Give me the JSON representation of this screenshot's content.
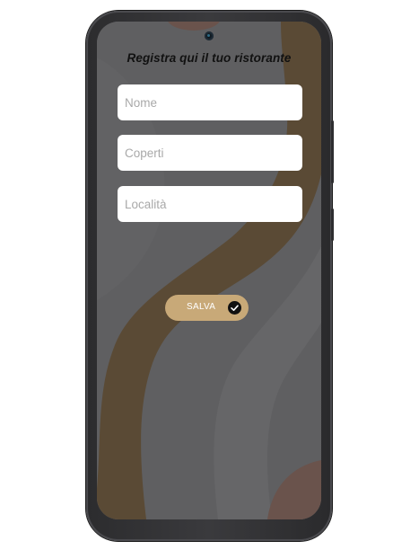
{
  "app": {
    "title": "Registra qui il tuo ristorante"
  },
  "form": {
    "name_placeholder": "Nome",
    "covers_placeholder": "Coperti",
    "location_placeholder": "Località",
    "save_label": "SALVA"
  },
  "colors": {
    "background": "#5f5f61",
    "wave_brown": "#5a4a35",
    "accent_blob": "#6a534c",
    "button": "#c8a978",
    "check_icon": "#111111"
  },
  "icons": {
    "save_icon": "check-circle-icon",
    "camera": "front-camera-icon"
  }
}
